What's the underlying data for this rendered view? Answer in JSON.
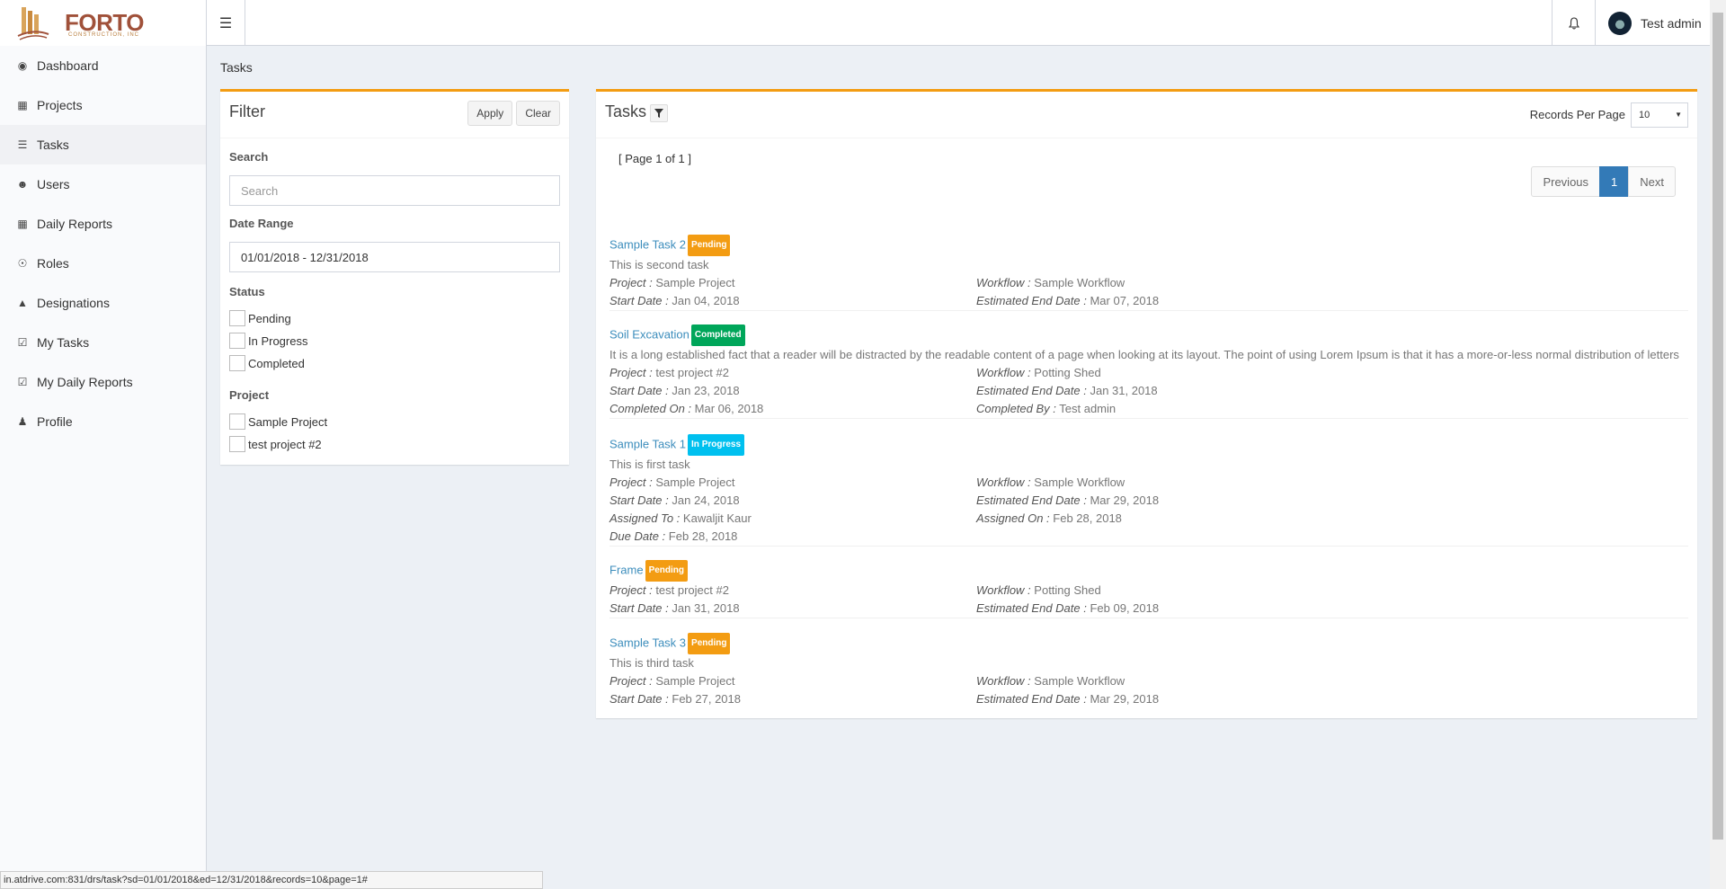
{
  "brand": {
    "name": "FORTO",
    "sub": "CONSTRUCTION, INC"
  },
  "header": {
    "user_name": "Test admin"
  },
  "sidebar": {
    "items": [
      {
        "label": "Dashboard",
        "icon": "dashboard-icon"
      },
      {
        "label": "Projects",
        "icon": "building-icon"
      },
      {
        "label": "Tasks",
        "icon": "tasks-icon",
        "active": true
      },
      {
        "label": "Users",
        "icon": "users-icon"
      },
      {
        "label": "Daily Reports",
        "icon": "calendar-icon"
      },
      {
        "label": "Roles",
        "icon": "user-circle-icon"
      },
      {
        "label": "Designations",
        "icon": "graduation-cap-icon"
      },
      {
        "label": "My Tasks",
        "icon": "check-square-icon"
      },
      {
        "label": "My Daily Reports",
        "icon": "calendar-check-icon"
      },
      {
        "label": "Profile",
        "icon": "user-icon"
      }
    ]
  },
  "breadcrumb": "Tasks",
  "filter": {
    "title": "Filter",
    "apply_label": "Apply",
    "clear_label": "Clear",
    "search_label": "Search",
    "search_placeholder": "Search",
    "date_range_label": "Date Range",
    "date_range_value": "01/01/2018 - 12/31/2018",
    "status_label": "Status",
    "status_options": [
      "Pending",
      "In Progress",
      "Completed"
    ],
    "project_label": "Project",
    "project_options": [
      "Sample Project",
      "test project #2"
    ]
  },
  "tasks_panel": {
    "title": "Tasks",
    "records_per_page_label": "Records Per Page",
    "records_per_page_value": "10",
    "page_info": "[ Page 1 of 1 ]",
    "pager": {
      "previous": "Previous",
      "current": "1",
      "next": "Next"
    }
  },
  "tasks": [
    {
      "name": "Sample Task 2",
      "status": "Pending",
      "description": "This is second task",
      "rows": [
        [
          [
            "Project :",
            "Sample Project"
          ],
          [
            "Workflow :",
            "Sample Workflow"
          ]
        ],
        [
          [
            "Start Date :",
            "Jan 04, 2018"
          ],
          [
            "Estimated End Date :",
            "Mar 07, 2018"
          ]
        ]
      ]
    },
    {
      "name": "Soil Excavation",
      "status": "Completed",
      "description": "It is a long established fact that a reader will be distracted by the readable content of a page when looking at its layout. The point of using Lorem Ipsum is that it has a more-or-less normal distribution of letters",
      "rows": [
        [
          [
            "Project :",
            "test project #2"
          ],
          [
            "Workflow :",
            "Potting Shed"
          ]
        ],
        [
          [
            "Start Date :",
            "Jan 23, 2018"
          ],
          [
            "Estimated End Date :",
            "Jan 31, 2018"
          ]
        ],
        [
          [
            "Completed On :",
            "Mar 06, 2018"
          ],
          [
            "Completed By :",
            "Test admin"
          ]
        ]
      ]
    },
    {
      "name": "Sample Task 1",
      "status": "In Progress",
      "description": "This is first task",
      "rows": [
        [
          [
            "Project :",
            "Sample Project"
          ],
          [
            "Workflow :",
            "Sample Workflow"
          ]
        ],
        [
          [
            "Start Date :",
            "Jan 24, 2018"
          ],
          [
            "Estimated End Date :",
            "Mar 29, 2018"
          ]
        ],
        [
          [
            "Assigned To :",
            "Kawaljit Kaur"
          ],
          [
            "Assigned On :",
            "Feb 28, 2018"
          ]
        ],
        [
          [
            "Due Date :",
            "Feb 28, 2018"
          ]
        ]
      ]
    },
    {
      "name": "Frame",
      "status": "Pending",
      "description": "",
      "rows": [
        [
          [
            "Project :",
            "test project #2"
          ],
          [
            "Workflow :",
            "Potting Shed"
          ]
        ],
        [
          [
            "Start Date :",
            "Jan 31, 2018"
          ],
          [
            "Estimated End Date :",
            "Feb 09, 2018"
          ]
        ]
      ]
    },
    {
      "name": "Sample Task 3",
      "status": "Pending",
      "description": "This is third task",
      "rows": [
        [
          [
            "Project :",
            "Sample Project"
          ],
          [
            "Workflow :",
            "Sample Workflow"
          ]
        ],
        [
          [
            "Start Date :",
            "Feb 27, 2018"
          ],
          [
            "Estimated End Date :",
            "Mar 29, 2018"
          ]
        ]
      ]
    }
  ],
  "status_bar_url": "in.atdrive.com:831/drs/task?sd=01/01/2018&ed=12/31/2018&records=10&page=1#",
  "colors": {
    "accent": "#f39c12",
    "link": "#3c8dbc",
    "pending": "#f39c12",
    "completed": "#00a65a",
    "in_progress": "#00c0ef",
    "pager_active": "#337ab7"
  }
}
